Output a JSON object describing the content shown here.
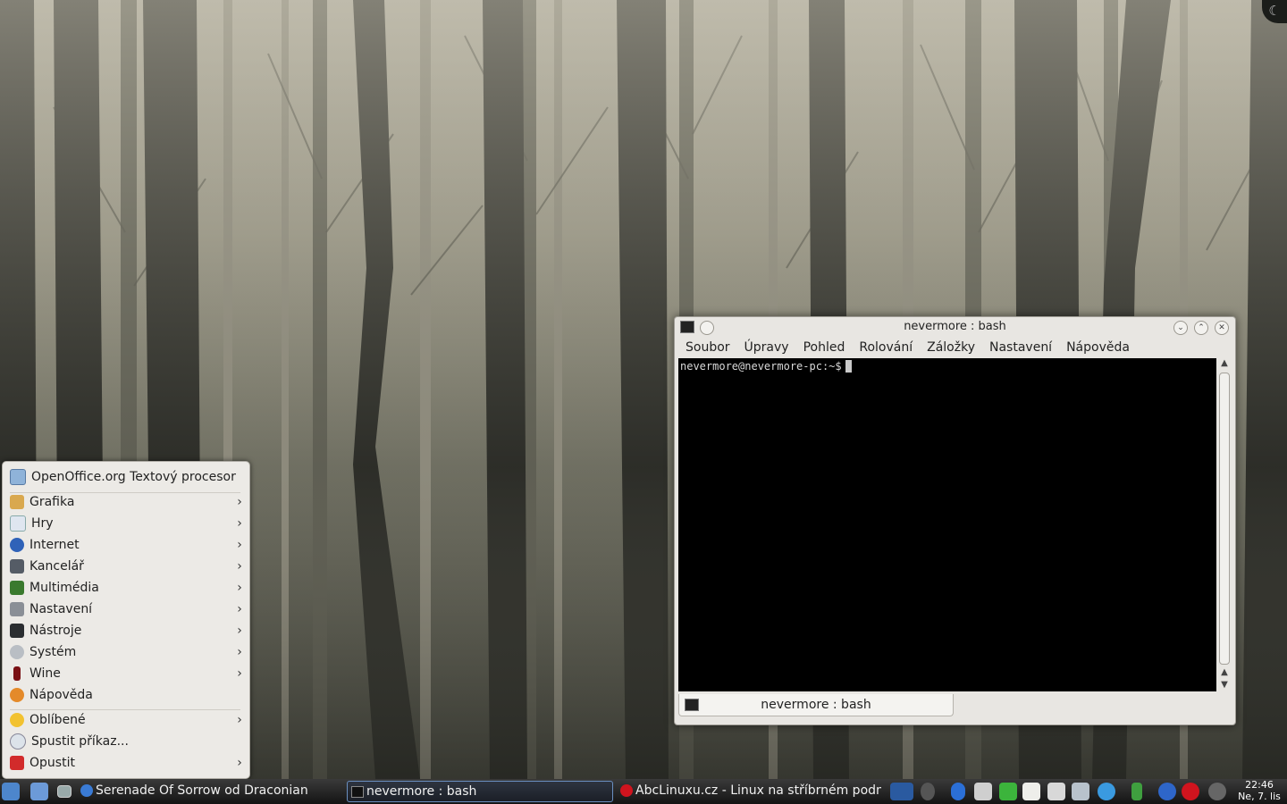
{
  "desktop": {
    "corner_icon": "☾"
  },
  "menu": {
    "recent": {
      "label": "OpenOffice.org Textový procesor",
      "icon": "writer-icon"
    },
    "categories": [
      {
        "label": "Grafika",
        "icon": "graphics-icon",
        "arrow": "›"
      },
      {
        "label": "Hry",
        "icon": "games-icon",
        "arrow": "›"
      },
      {
        "label": "Internet",
        "icon": "internet-icon",
        "arrow": "›"
      },
      {
        "label": "Kancelář",
        "icon": "office-icon",
        "arrow": "›"
      },
      {
        "label": "Multimédia",
        "icon": "multimedia-icon",
        "arrow": "›"
      },
      {
        "label": "Nastavení",
        "icon": "settings-icon",
        "arrow": "›"
      },
      {
        "label": "Nástroje",
        "icon": "tools-icon",
        "arrow": "›"
      },
      {
        "label": "Systém",
        "icon": "system-icon",
        "arrow": "›"
      },
      {
        "label": "Wine",
        "icon": "wine-icon",
        "arrow": "›"
      },
      {
        "label": "Nápověda",
        "icon": "help-icon",
        "arrow": ""
      }
    ],
    "bottom": [
      {
        "label": "Oblíbené",
        "icon": "favorites-icon",
        "arrow": "›"
      },
      {
        "label": "Spustit příkaz...",
        "icon": "run-command-icon",
        "arrow": ""
      },
      {
        "label": "Opustit",
        "icon": "leave-icon",
        "arrow": "›"
      }
    ]
  },
  "konsole": {
    "title": "nevermore : bash",
    "menu": [
      "Soubor",
      "Úpravy",
      "Pohled",
      "Rolování",
      "Záložky",
      "Nastavení",
      "Nápověda"
    ],
    "prompt": "nevermore@nevermore-pc:~$",
    "tab_label": "nevermore : bash",
    "buttons": {
      "minimize": "⌄",
      "maximize": "⌃",
      "close": "✕"
    }
  },
  "taskbar": {
    "tasks": [
      {
        "label": "Serenade Of Sorrow od Draconian",
        "icon": "amarok-icon"
      },
      {
        "label": "nevermore : bash",
        "icon": "terminal-icon",
        "active": true
      },
      {
        "label": "AbcLinuxu.cz - Linux na stříbrném podnosu",
        "icon": "opera-icon"
      }
    ],
    "clock": {
      "time": "22:46",
      "date": "Ne, 7. lis"
    },
    "tray_icons": [
      "pager-icon",
      "back-icon",
      "bluetooth-icon",
      "volume-icon",
      "update-icon",
      "clipboard-icon",
      "network-icon",
      "display-icon",
      "kopete-icon",
      "battery-icon",
      "amarok-tray-icon",
      "opera-tray-icon",
      "info-icon"
    ],
    "colors": {
      "accent": "#6a8fc0"
    }
  }
}
